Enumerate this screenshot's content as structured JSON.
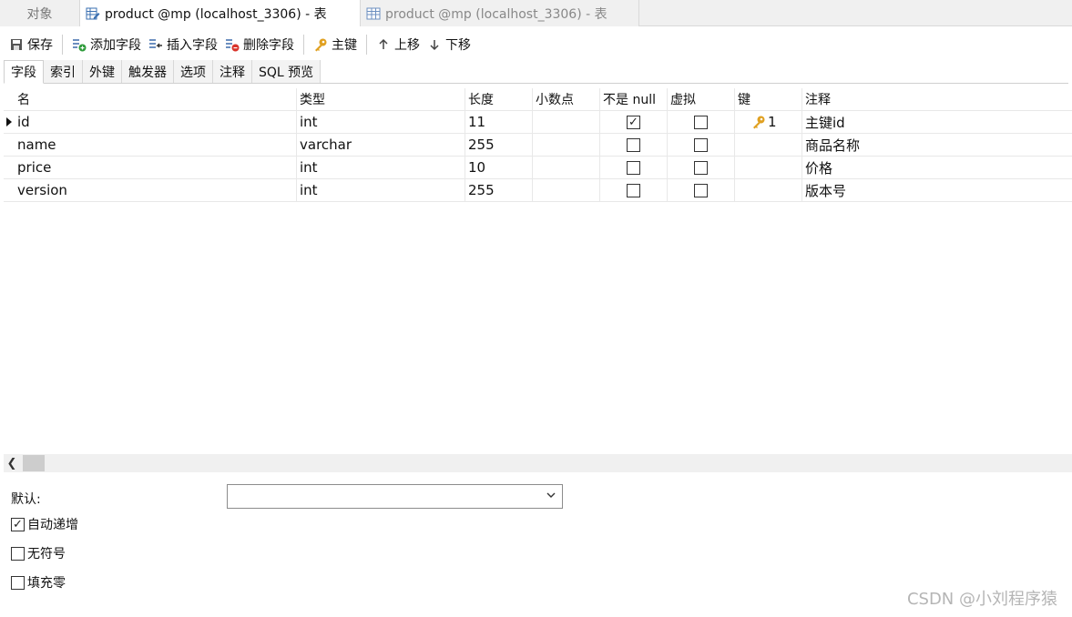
{
  "tabs": [
    {
      "label": "对象"
    },
    {
      "label": "product @mp (localhost_3306) - 表"
    },
    {
      "label": "product @mp (localhost_3306) - 表"
    }
  ],
  "toolbar": {
    "save": "保存",
    "add_field": "添加字段",
    "insert_field": "插入字段",
    "delete_field": "删除字段",
    "primary_key": "主键",
    "move_up": "上移",
    "move_down": "下移"
  },
  "subtabs": [
    "字段",
    "索引",
    "外键",
    "触发器",
    "选项",
    "注释",
    "SQL 预览"
  ],
  "grid": {
    "headers": {
      "name": "名",
      "type": "类型",
      "length": "长度",
      "decimals": "小数点",
      "not_null": "不是 null",
      "virtual": "虚拟",
      "key": "键",
      "comment": "注释"
    },
    "rows": [
      {
        "name": "id",
        "type": "int",
        "length": "11",
        "decimals": "",
        "not_null": true,
        "virtual": false,
        "key": "1",
        "comment": "主键id"
      },
      {
        "name": "name",
        "type": "varchar",
        "length": "255",
        "decimals": "",
        "not_null": false,
        "virtual": false,
        "key": "",
        "comment": "商品名称"
      },
      {
        "name": "price",
        "type": "int",
        "length": "10",
        "decimals": "",
        "not_null": false,
        "virtual": false,
        "key": "",
        "comment": "价格"
      },
      {
        "name": "version",
        "type": "int",
        "length": "255",
        "decimals": "",
        "not_null": false,
        "virtual": false,
        "key": "",
        "comment": "版本号"
      }
    ]
  },
  "properties": {
    "default_label": "默认:",
    "default_value": "",
    "auto_increment_label": "自动递增",
    "auto_increment": true,
    "unsigned_label": "无符号",
    "unsigned": false,
    "zerofill_label": "填充零",
    "zerofill": false
  },
  "watermark": "CSDN @小刘程序猿",
  "colors": {
    "key_icon": "#e0a020",
    "accent_blue": "#3a6fb0",
    "delete_red": "#d9342b",
    "add_green": "#2e9b3a"
  }
}
